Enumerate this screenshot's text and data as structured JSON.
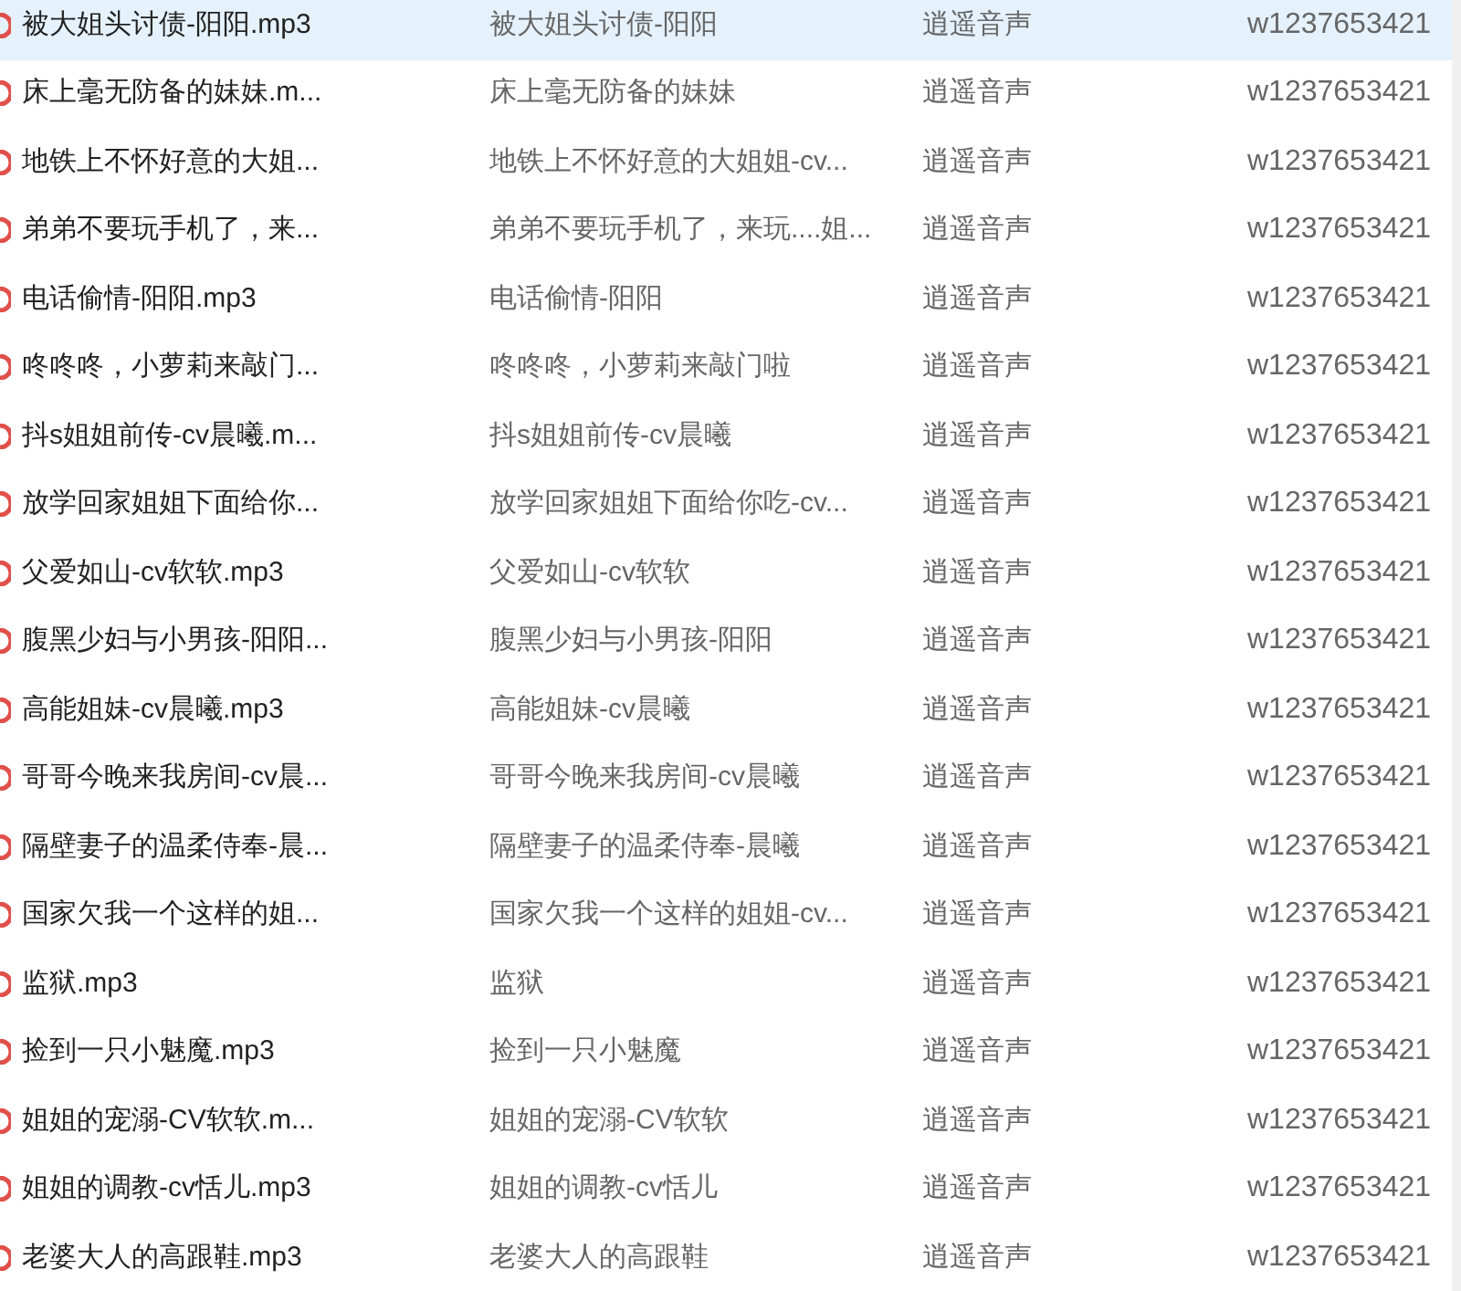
{
  "table": {
    "rows": [
      {
        "file": "被大姐头讨债-阳阳.mp3",
        "title": "被大姐头讨债-阳阳",
        "artist": "逍遥音声",
        "album": "w1237653421",
        "selected": true
      },
      {
        "file": "床上毫无防备的妹妹.m...",
        "title": "床上毫无防备的妹妹",
        "artist": "逍遥音声",
        "album": "w1237653421",
        "selected": false
      },
      {
        "file": "地铁上不怀好意的大姐...",
        "title": "地铁上不怀好意的大姐姐-cv...",
        "artist": "逍遥音声",
        "album": "w1237653421",
        "selected": false
      },
      {
        "file": "弟弟不要玩手机了，来...",
        "title": "弟弟不要玩手机了，来玩....姐...",
        "artist": "逍遥音声",
        "album": "w1237653421",
        "selected": false
      },
      {
        "file": "电话偷情-阳阳.mp3",
        "title": "电话偷情-阳阳",
        "artist": "逍遥音声",
        "album": "w1237653421",
        "selected": false
      },
      {
        "file": "咚咚咚，小萝莉来敲门...",
        "title": "咚咚咚，小萝莉来敲门啦",
        "artist": "逍遥音声",
        "album": "w1237653421",
        "selected": false
      },
      {
        "file": "抖s姐姐前传-cv晨曦.m...",
        "title": "抖s姐姐前传-cv晨曦",
        "artist": "逍遥音声",
        "album": "w1237653421",
        "selected": false
      },
      {
        "file": "放学回家姐姐下面给你...",
        "title": "放学回家姐姐下面给你吃-cv...",
        "artist": "逍遥音声",
        "album": "w1237653421",
        "selected": false
      },
      {
        "file": "父爱如山-cv软软.mp3",
        "title": "父爱如山-cv软软",
        "artist": "逍遥音声",
        "album": "w1237653421",
        "selected": false
      },
      {
        "file": "腹黑少妇与小男孩-阳阳...",
        "title": "腹黑少妇与小男孩-阳阳",
        "artist": "逍遥音声",
        "album": "w1237653421",
        "selected": false
      },
      {
        "file": "高能姐妹-cv晨曦.mp3",
        "title": "高能姐妹-cv晨曦",
        "artist": "逍遥音声",
        "album": "w1237653421",
        "selected": false
      },
      {
        "file": "哥哥今晚来我房间-cv晨...",
        "title": "哥哥今晚来我房间-cv晨曦",
        "artist": "逍遥音声",
        "album": "w1237653421",
        "selected": false
      },
      {
        "file": "隔壁妻子的温柔侍奉-晨...",
        "title": "隔壁妻子的温柔侍奉-晨曦",
        "artist": "逍遥音声",
        "album": "w1237653421",
        "selected": false
      },
      {
        "file": "国家欠我一个这样的姐...",
        "title": "国家欠我一个这样的姐姐-cv...",
        "artist": "逍遥音声",
        "album": "w1237653421",
        "selected": false
      },
      {
        "file": "监狱.mp3",
        "title": "监狱",
        "artist": "逍遥音声",
        "album": "w1237653421",
        "selected": false
      },
      {
        "file": "捡到一只小魅魔.mp3",
        "title": "捡到一只小魅魔",
        "artist": "逍遥音声",
        "album": "w1237653421",
        "selected": false
      },
      {
        "file": "姐姐的宠溺-CV软软.m...",
        "title": "姐姐的宠溺-CV软软",
        "artist": "逍遥音声",
        "album": "w1237653421",
        "selected": false
      },
      {
        "file": "姐姐的调教-cv恬儿.mp3",
        "title": "姐姐的调教-cv恬儿",
        "artist": "逍遥音声",
        "album": "w1237653421",
        "selected": false
      },
      {
        "file": "老婆大人的高跟鞋.mp3",
        "title": "老婆大人的高跟鞋",
        "artist": "逍遥音声",
        "album": "w1237653421",
        "selected": false
      }
    ]
  }
}
